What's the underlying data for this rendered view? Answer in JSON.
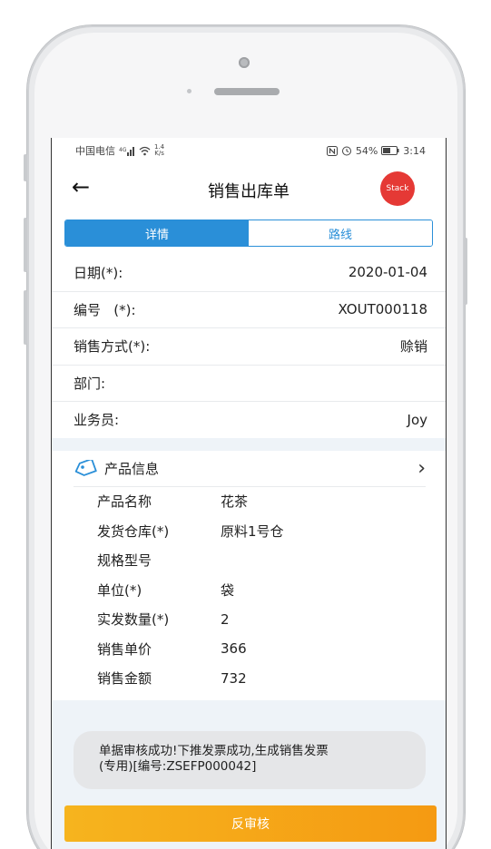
{
  "status": {
    "carrier": "中国电信",
    "net_speed_top": "1.4",
    "net_speed_bottom": "K/s",
    "battery": "54%",
    "time": "3:14",
    "icons": [
      "signal-icon",
      "wifi-icon",
      "nfc-icon",
      "alarm-icon",
      "battery-icon"
    ]
  },
  "header": {
    "title": "销售出库单",
    "stack_label": "Stack"
  },
  "tabs": [
    {
      "label": "详情",
      "active": true
    },
    {
      "label": "路线",
      "active": false
    }
  ],
  "fields": [
    {
      "label": "日期(*):",
      "value": "2020-01-04"
    },
    {
      "label": "编号   (*):",
      "value": "XOUT000118"
    },
    {
      "label": "销售方式(*):",
      "value": "赊销"
    },
    {
      "label": "部门:",
      "value": ""
    },
    {
      "label": "业务员:",
      "value": "Joy"
    }
  ],
  "product": {
    "section_title": "产品信息",
    "rows": [
      {
        "label": "产品名称",
        "value": "花茶"
      },
      {
        "label": "发货仓库(*)",
        "value": "原料1号仓"
      },
      {
        "label": "规格型号",
        "value": ""
      },
      {
        "label": "单位(*)",
        "value": "袋"
      },
      {
        "label": "实发数量(*)",
        "value": "2"
      },
      {
        "label": "销售单价",
        "value": "366"
      },
      {
        "label": "销售金额",
        "value": "732"
      }
    ]
  },
  "toast": {
    "line1": "单据审核成功!下推发票成功,生成销售发票",
    "line2": "(专用)[编号:ZSEFP000042]"
  },
  "action_button": "反审核",
  "colors": {
    "primary": "#2a8fd8",
    "stack_badge": "#e53935",
    "action": "#f5a818"
  }
}
